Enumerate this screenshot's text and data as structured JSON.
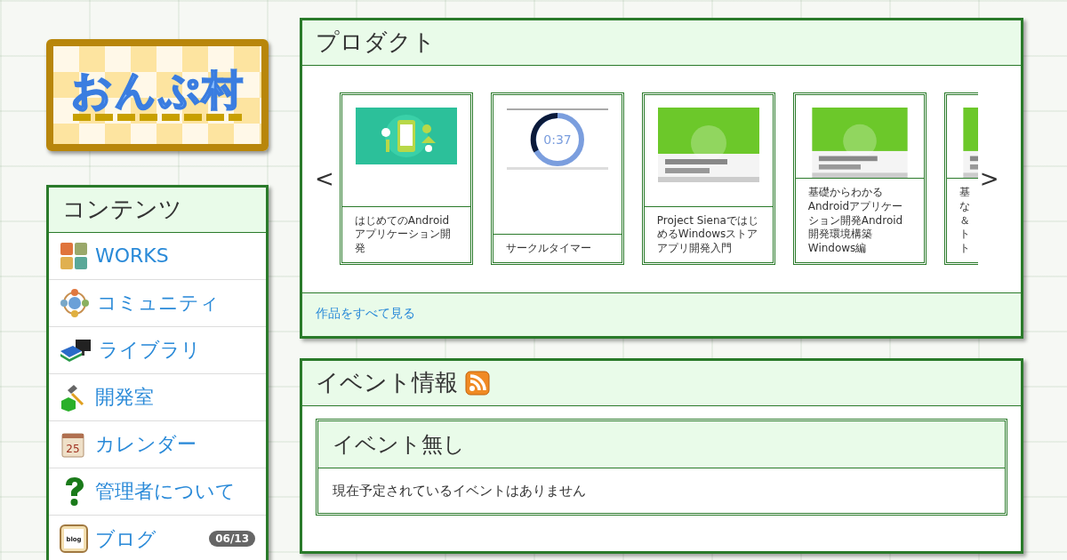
{
  "logo": {
    "text": "おんぷ村"
  },
  "sidebar": {
    "title": "コンテンツ",
    "items": [
      {
        "kind": "works",
        "label": "WORKS"
      },
      {
        "kind": "community",
        "label": "コミュニティ"
      },
      {
        "kind": "library",
        "label": "ライブラリ"
      },
      {
        "kind": "dev",
        "label": "開発室"
      },
      {
        "kind": "calendar",
        "label": "カレンダー",
        "icon_text": "25"
      },
      {
        "kind": "admin",
        "label": "管理者について"
      },
      {
        "kind": "blog",
        "label": "ブログ",
        "icon_text": "blog",
        "badge": "06/13"
      }
    ]
  },
  "products": {
    "title": "プロダクト",
    "prev": "<",
    "next": ">",
    "footer_link": "作品をすべて見る",
    "items": [
      {
        "kind": "banner",
        "caption": "はじめてのAndroidアプリケーション開発"
      },
      {
        "kind": "timer",
        "timer_text": "0:37",
        "caption": "サークルタイマー"
      },
      {
        "kind": "cover",
        "caption": "Project SienaではじめるWindowsストアアプリ開発入門"
      },
      {
        "kind": "cover",
        "caption": "基礎からわかるAndroidアプリケーション開発Android開発環境構築Windows編"
      },
      {
        "kind": "cover",
        "caption_lines": [
          "基",
          "な",
          "＆",
          "ト",
          "ト"
        ]
      }
    ]
  },
  "events": {
    "title": "イベント情報",
    "items": [
      {
        "title": "イベント無し",
        "text": "現在予定されているイベントはありません"
      }
    ]
  }
}
